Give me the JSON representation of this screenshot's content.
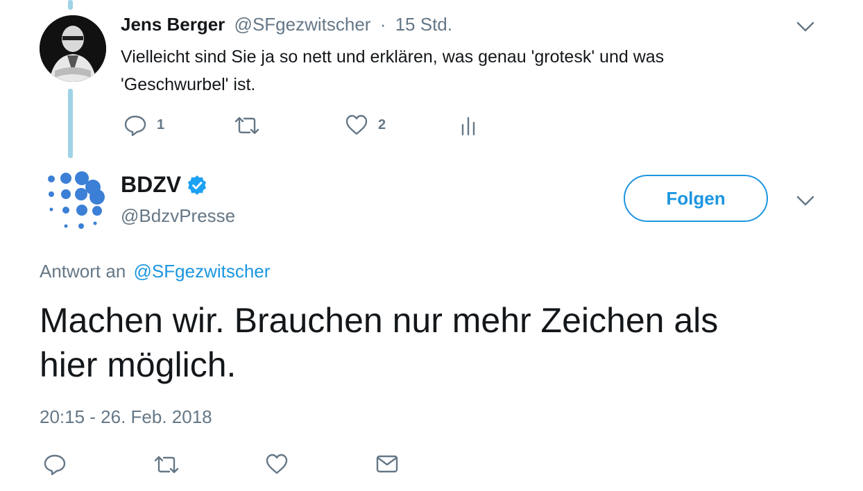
{
  "parent_tweet": {
    "author_name": "Jens Berger",
    "handle": "@SFgezwitscher",
    "separator": "·",
    "time": "15 Std.",
    "text_line1": "Vielleicht sind Sie ja so nett und erklären, was genau 'grotesk' und was",
    "text_line2": "'Geschwurbel' ist.",
    "actions": {
      "reply_count": "1",
      "like_count": "2"
    }
  },
  "main_tweet": {
    "author_name": "BDZV",
    "handle": "@BdzvPresse",
    "follow_label": "Folgen",
    "reply_prefix": "Antwort an",
    "reply_to": "@SFgezwitscher",
    "text_line1": "Machen wir. Brauchen nur mehr Zeichen als",
    "text_line2": "hier möglich.",
    "timestamp": "20:15 - 26. Feb. 2018"
  },
  "colors": {
    "accent": "#1b95e0",
    "muted": "#657786",
    "thread_line": "#9fd2e6",
    "logo_blue": "#3b7fd6",
    "verified": "#1da1f2"
  },
  "icons": [
    "reply-icon",
    "retweet-icon",
    "like-icon",
    "analytics-icon",
    "message-icon",
    "chevron-down-icon",
    "verified-icon"
  ]
}
